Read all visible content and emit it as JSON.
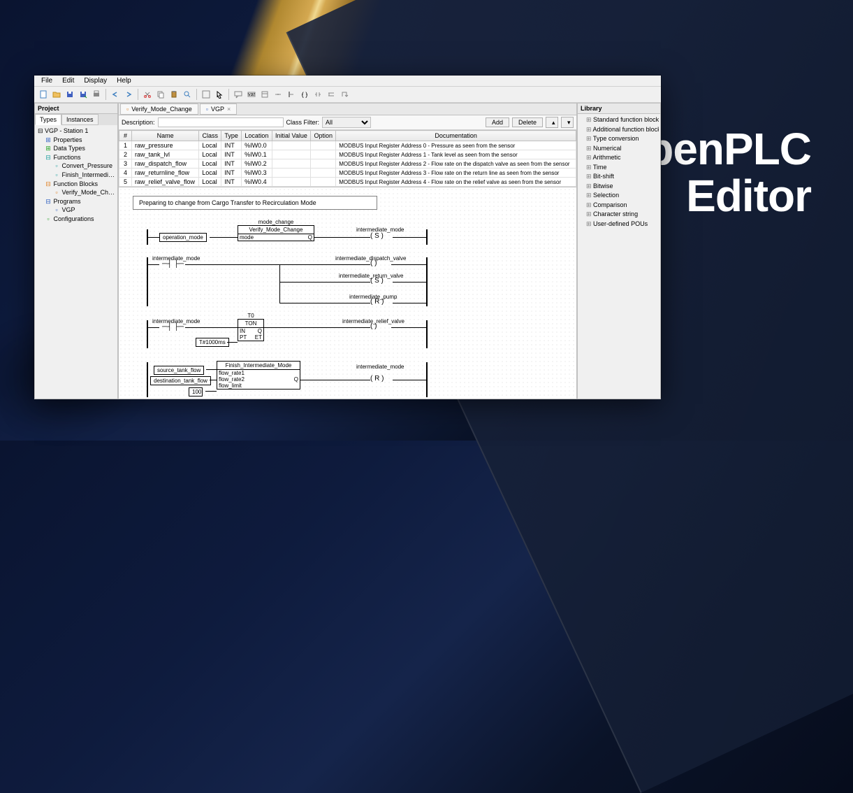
{
  "hero": {
    "line1": "OpenPLC",
    "line2": "Editor"
  },
  "menu": [
    "File",
    "Edit",
    "Display",
    "Help"
  ],
  "left_panel": {
    "title": "Project",
    "tabs": [
      "Types",
      "Instances"
    ],
    "root": "VGP - Station 1",
    "items": [
      {
        "level": 1,
        "icon": "⊞",
        "cls": "ic-blue",
        "label": "Properties"
      },
      {
        "level": 1,
        "icon": "⊞",
        "cls": "ic-green",
        "label": "Data Types"
      },
      {
        "level": 1,
        "icon": "⊟",
        "cls": "ic-teal",
        "label": "Functions"
      },
      {
        "level": 2,
        "icon": "▫",
        "cls": "ic-teal",
        "label": "Convert_Pressure"
      },
      {
        "level": 2,
        "icon": "▫",
        "cls": "ic-teal",
        "label": "Finish_Intermediate_Mode"
      },
      {
        "level": 1,
        "icon": "⊟",
        "cls": "ic-orange",
        "label": "Function Blocks"
      },
      {
        "level": 2,
        "icon": "▫",
        "cls": "ic-orange",
        "label": "Verify_Mode_Change"
      },
      {
        "level": 1,
        "icon": "⊟",
        "cls": "ic-blue",
        "label": "Programs"
      },
      {
        "level": 2,
        "icon": "▫",
        "cls": "ic-blue",
        "label": "VGP"
      },
      {
        "level": 1,
        "icon": "▫",
        "cls": "ic-green",
        "label": "Configurations"
      }
    ]
  },
  "editor_tabs": [
    {
      "icon": "▫",
      "label": "Verify_Mode_Change"
    },
    {
      "icon": "▫",
      "label": "VGP"
    }
  ],
  "desc_bar": {
    "desc_label": "Description:",
    "filter_label": "Class Filter:",
    "filter_value": "All",
    "add": "Add",
    "delete": "Delete"
  },
  "var_table": {
    "headers": [
      "#",
      "Name",
      "Class",
      "Type",
      "Location",
      "Initial Value",
      "Option",
      "Documentation"
    ],
    "rows": [
      [
        "1",
        "raw_pressure",
        "Local",
        "INT",
        "%IW0.0",
        "",
        "",
        "MODBUS Input Register Address 0 - Pressure as seen from the sensor"
      ],
      [
        "2",
        "raw_tank_lvl",
        "Local",
        "INT",
        "%IW0.1",
        "",
        "",
        "MODBUS Input Register Address 1 - Tank level as seen from the sensor"
      ],
      [
        "3",
        "raw_dispatch_flow",
        "Local",
        "INT",
        "%IW0.2",
        "",
        "",
        "MODBUS Input Register Address 2 - Flow rate on the dispatch valve as seen from the sensor"
      ],
      [
        "4",
        "raw_returnline_flow",
        "Local",
        "INT",
        "%IW0.3",
        "",
        "",
        "MODBUS Input Register Address 3 - Flow rate on the return line as seen from the sensor"
      ],
      [
        "5",
        "raw_relief_valve_flow",
        "Local",
        "INT",
        "%IW0.4",
        "",
        "",
        "MODBUS Input Register Address 4 - Flow rate on the relief valve as seen from the sensor"
      ]
    ]
  },
  "diagram": {
    "comment": "Preparing to change from Cargo Transfer to Recirculation Mode",
    "vars": {
      "operation_mode": "operation_mode",
      "intermediate_mode": "intermediate_mode",
      "intermediate_dispatch_valve": "intermediate_dispatch_valve",
      "intermediate_return_valve": "intermediate_return_valve",
      "intermediate_pump": "intermediate_pump",
      "intermediate_relief_valve": "intermediate_relief_valve",
      "source_tank_flow": "source_tank_flow",
      "destination_tank_flow": "destination_tank_flow",
      "const_100": "100",
      "timer_val": "T#1000ms"
    },
    "blocks": {
      "mode_change": {
        "name": "mode_change",
        "type": "Verify_Mode_Change",
        "in": "mode",
        "out": "Q"
      },
      "ton": {
        "name": "T0",
        "type": "TON",
        "in1": "IN",
        "in2": "PT",
        "out1": "Q",
        "out2": "ET"
      },
      "finish": {
        "type": "Finish_Intermediate_Mode",
        "in1": "flow_rate1",
        "in2": "flow_rate2",
        "in3": "flow_limit",
        "out": "Q"
      }
    },
    "coils": {
      "S": "S",
      "R": "R"
    }
  },
  "library": {
    "title": "Library",
    "items": [
      "Standard function blocks",
      "Additional function blocks",
      "Type conversion",
      "Numerical",
      "Arithmetic",
      "Time",
      "Bit-shift",
      "Bitwise",
      "Selection",
      "Comparison",
      "Character string",
      "User-defined POUs"
    ]
  }
}
